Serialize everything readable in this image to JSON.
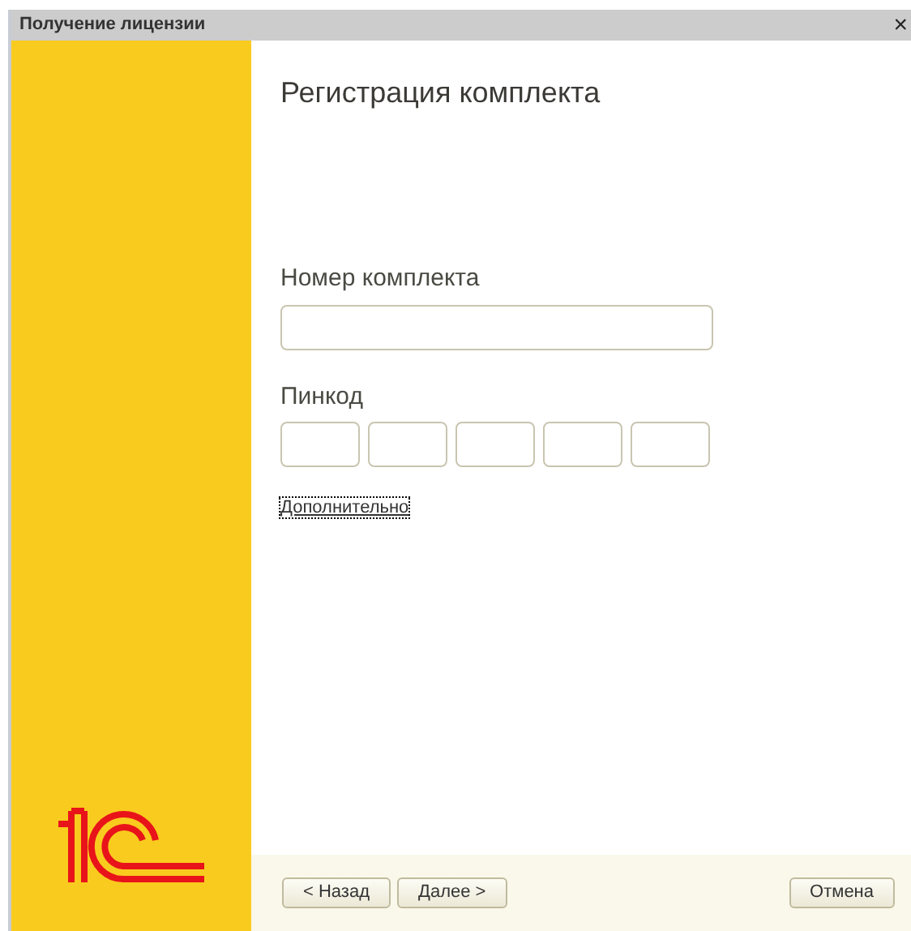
{
  "window": {
    "title": "Получение лицензии",
    "close": "×"
  },
  "heading": "Регистрация комплекта",
  "kit_number": {
    "label": "Номер комплекта"
  },
  "pincode": {
    "label": "Пинкод",
    "fields": [
      {
        "kind": "digit"
      },
      {
        "kind": "digit"
      },
      {
        "kind": "digit"
      },
      {
        "kind": "digit"
      },
      {
        "kind": "digit"
      }
    ]
  },
  "more_link": {
    "text": "Дополнительно",
    "focused": true
  },
  "buttons": [
    {
      "label": "< Назад",
      "kind": "nav"
    },
    {
      "label": "Далее >",
      "kind": "nav"
    },
    {
      "label": "Отмена",
      "kind": "cancel"
    }
  ]
}
